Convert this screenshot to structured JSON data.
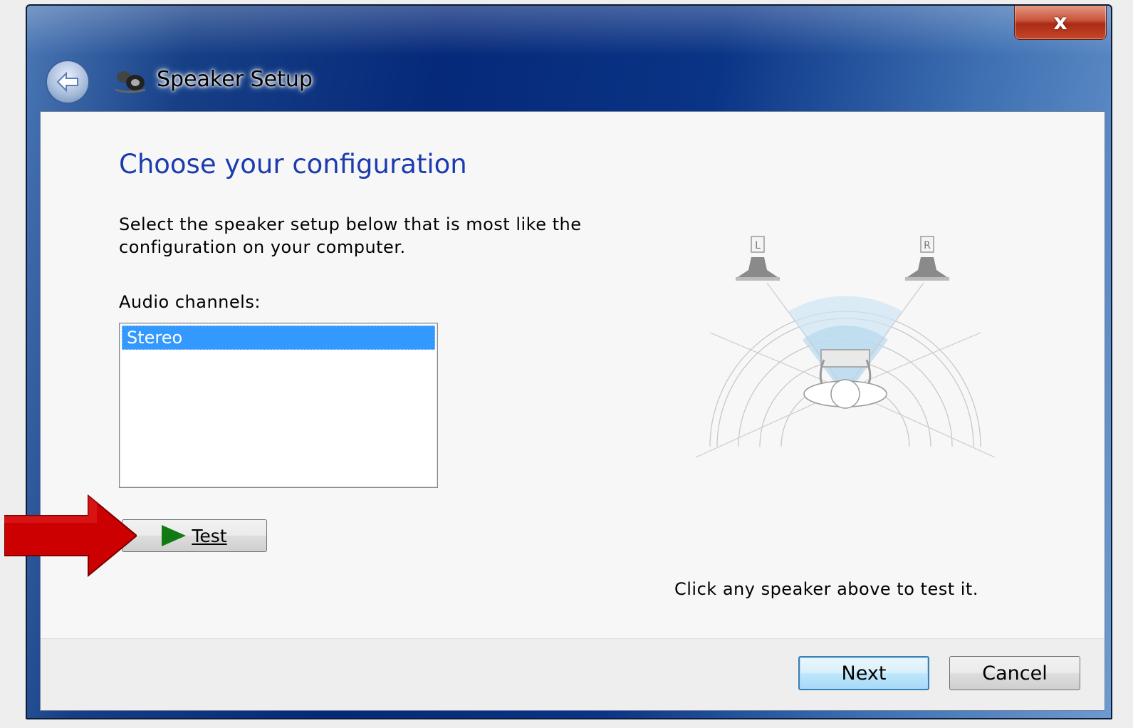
{
  "window": {
    "title": "Speaker Setup",
    "close_label": "x"
  },
  "page": {
    "heading": "Choose your configuration",
    "description": "Select the speaker setup below that is most like the configuration on your computer.",
    "list_label": "Audio channels:",
    "channels": [
      "Stereo"
    ],
    "selected_channel": "Stereo",
    "test_label": "Test",
    "diagram_left_label": "L",
    "diagram_right_label": "R",
    "hint": "Click any speaker above to test it."
  },
  "footer": {
    "next_label": "Next",
    "cancel_label": "Cancel"
  },
  "colors": {
    "heading": "#1c3cae",
    "selection": "#3399ff",
    "annotation_arrow": "#cc0000",
    "play": "#137a13"
  }
}
